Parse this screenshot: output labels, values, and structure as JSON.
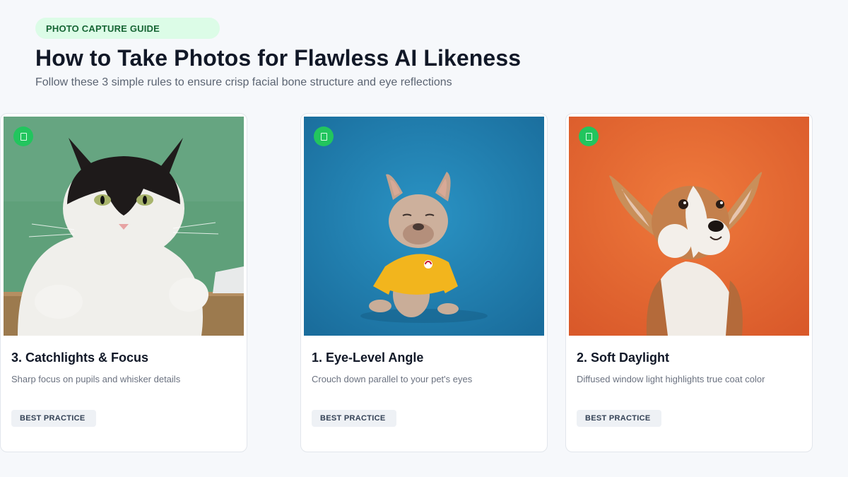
{
  "header": {
    "tag": "PHOTO CAPTURE GUIDE",
    "title": "How to Take Photos for Flawless AI Likeness",
    "subtitle": "Follow these 3 simple rules to ensure crisp facial bone structure and eye reflections"
  },
  "colors": {
    "accent_green": "#22c55e",
    "pill_bg": "#dcfce7",
    "pill_text": "#166534",
    "page_bg": "#f6f8fb"
  },
  "cards": [
    {
      "title": "1. Eye-Level Angle",
      "description": "Crouch down parallel to your pet's eyes",
      "tag": "BEST PRACTICE",
      "badge_icon": "check-icon",
      "photo": "french bulldog in yellow shirt on blue background"
    },
    {
      "title": "2. Soft Daylight",
      "description": "Diffused window light highlights true coat color",
      "tag": "BEST PRACTICE",
      "badge_icon": "check-icon",
      "photo": "corgi puppy on orange background"
    },
    {
      "title": "3. Catchlights & Focus",
      "description": "Sharp focus on pupils and whisker details",
      "tag": "BEST PRACTICE",
      "badge_icon": "check-icon",
      "photo": "black and white cat on green background"
    }
  ]
}
